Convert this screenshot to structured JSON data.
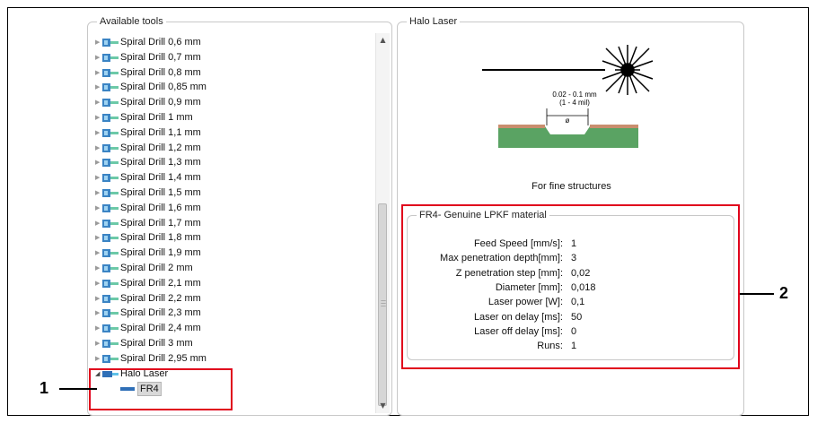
{
  "tools_panel": {
    "title": "Available tools",
    "drills": [
      "Spiral Drill  0,6 mm",
      "Spiral Drill  0,7 mm",
      "Spiral Drill  0,8 mm",
      "Spiral Drill  0,85 mm",
      "Spiral Drill  0,9 mm",
      "Spiral Drill  1 mm",
      "Spiral Drill  1,1 mm",
      "Spiral Drill  1,2 mm",
      "Spiral Drill  1,3 mm",
      "Spiral Drill  1,4 mm",
      "Spiral Drill  1,5 mm",
      "Spiral Drill  1,6 mm",
      "Spiral Drill  1,7 mm",
      "Spiral Drill  1,8 mm",
      "Spiral Drill  1,9 mm",
      "Spiral Drill  2 mm",
      "Spiral Drill  2,1 mm",
      "Spiral Drill  2,2 mm",
      "Spiral Drill  2,3 mm",
      "Spiral Drill  2,4 mm",
      "Spiral Drill  3 mm",
      "Spiral Drill  2,95 mm"
    ],
    "halo_node": "Halo Laser",
    "halo_child": "FR4"
  },
  "halo_panel": {
    "title": "Halo Laser",
    "diagram": {
      "width_label": "0.02 - 0.1 mm",
      "width_label_mil": "(1 - 4 mil)",
      "diameter_symbol": "ø"
    },
    "caption": "For fine structures",
    "material": {
      "title": "FR4- Genuine LPKF material",
      "params": [
        {
          "label": "Feed Speed [mm/s]:",
          "value": "1"
        },
        {
          "label": "Max penetration depth[mm]:",
          "value": "3"
        },
        {
          "label": "Z penetration step [mm]:",
          "value": "0,02"
        },
        {
          "label": "Diameter [mm]:",
          "value": "0,018"
        },
        {
          "label": "Laser power [W]:",
          "value": "0,1"
        },
        {
          "label": "Laser on delay [ms]:",
          "value": "50"
        },
        {
          "label": "Laser off delay [ms]:",
          "value": "0"
        },
        {
          "label": "Runs:",
          "value": "1"
        }
      ]
    }
  },
  "callouts": {
    "one": "1",
    "two": "2"
  },
  "colors": {
    "highlight": "#e0001b",
    "pcb_substrate": "#5aa363",
    "pcb_copper": "#c98e6e",
    "tree_selection": "#d9d9d9"
  },
  "icons": {
    "drill": "drill-tool-icon",
    "laser": "laser-tool-icon",
    "tree_expand": "tree-expand-arrow-icon"
  }
}
